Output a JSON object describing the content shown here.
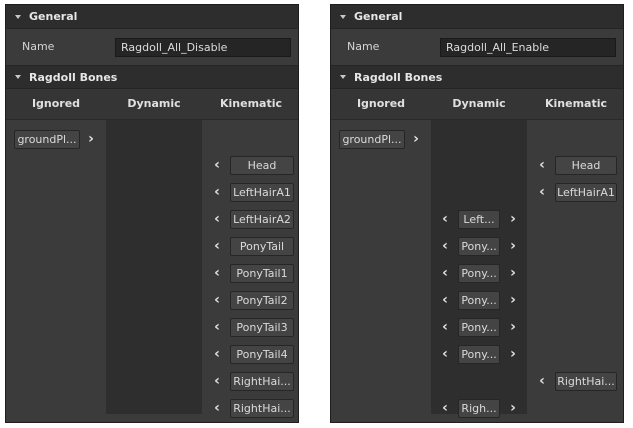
{
  "left": {
    "general_title": "General",
    "name_label": "Name",
    "name_value": "Ragdoll_All_Disable",
    "bones_title": "Ragdoll Bones",
    "columns": [
      "Ignored",
      "Dynamic",
      "Kinematic"
    ],
    "ignored": [
      "groundPl..."
    ],
    "dynamic": [],
    "kinematic": [
      "Head",
      "LeftHairA1",
      "LeftHairA2",
      "PonyTail",
      "PonyTail1",
      "PonyTail2",
      "PonyTail3",
      "PonyTail4",
      "RightHai...",
      "RightHai..."
    ]
  },
  "right": {
    "general_title": "General",
    "name_label": "Name",
    "name_value": "Ragdoll_All_Enable",
    "bones_title": "Ragdoll Bones",
    "columns": [
      "Ignored",
      "Dynamic",
      "Kinematic"
    ],
    "ignored": [
      "groundPl..."
    ],
    "dynamic": [
      "Left...",
      "Pony...",
      "Pony...",
      "Pony...",
      "Pony...",
      "Pony...",
      "Righ..."
    ],
    "kinematic": [
      "Head",
      "LeftHairA1",
      "RightHai..."
    ]
  },
  "icons": {
    "arrow_left": "‹",
    "arrow_right": "›"
  }
}
